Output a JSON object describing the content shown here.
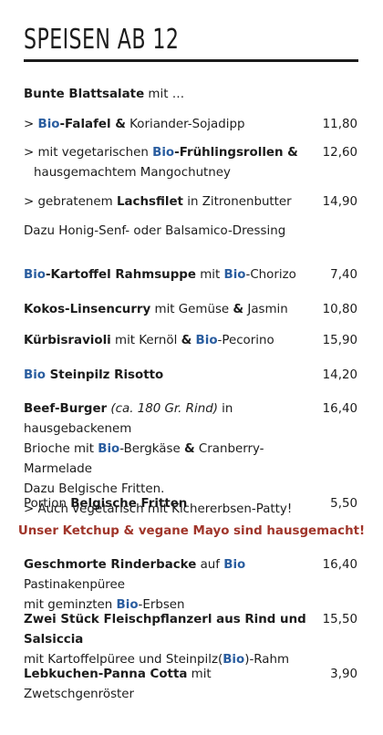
{
  "title": "SPEISEN AB 12",
  "salads": {
    "heading_bold": "Bunte Blattsalate",
    "heading_rest": " mit …",
    "falafel": {
      "prefix": "> ",
      "bio": "Bio",
      "name": "-Falafel &",
      "rest": " Koriander-Sojadipp",
      "price": "11,80"
    },
    "spring_rolls": {
      "line1_a": "> mit vegetarischen ",
      "bio": "Bio",
      "name": "-Frühlingsrollen &",
      "line2": "hausgemachtem Mangochutney",
      "price": "12,60"
    },
    "salmon": {
      "line_a": "> gebratenem ",
      "name": "Lachsfilet",
      "rest": " in Zitronenbutter",
      "price": "14,90"
    },
    "dressing": "Dazu Honig-Senf- oder Balsamico-Dressing"
  },
  "soup": {
    "bio1": "Bio",
    "name": "-Kartoffel Rahmsuppe",
    "mid": " mit ",
    "bio2": "Bio",
    "rest": "-Chorizo",
    "price": "7,40"
  },
  "curry": {
    "name": "Kokos-Linsencurry",
    "rest_a": " mit Gemüse ",
    "amp": "&",
    "rest_b": " Jasmin",
    "price": "10,80"
  },
  "ravioli": {
    "name": "Kürbisravioli",
    "rest_a": " mit Kernöl ",
    "amp": "&",
    "space": " ",
    "bio": "Bio",
    "rest_b": "-Pecorino",
    "price": "15,90"
  },
  "risotto": {
    "bio": "Bio",
    "name": " Steinpilz Risotto",
    "price": "14,20"
  },
  "burger": {
    "name": "Beef-Burger",
    "weight": " (ca. 180 Gr. Rind)",
    "rest1": " in hausgebackenem",
    "line2_a": "Brioche mit ",
    "bio": "Bio",
    "line2_b": "-Bergkäse ",
    "amp": "&",
    "line2_c": " Cranberry-Marmelade",
    "line3": "Dazu Belgische Fritten.",
    "line4": "> Auch vegetarisch mit Kichererbsen-Patty!",
    "price": "16,40"
  },
  "fries": {
    "prefix": "Portion ",
    "name": "Belgische Fritten",
    "price": "5,50"
  },
  "ketchup_note": "Unser Ketchup & vegane Mayo sind hausgemacht!",
  "cheek": {
    "name": "Geschmorte Rinderbacke",
    "mid": " auf ",
    "bio1": "Bio",
    "rest1": " Pastinakenpüree",
    "line2_a": "mit geminzten ",
    "bio2": "Bio",
    "line2_b": "-Erbsen",
    "price": "16,40"
  },
  "fleischpflanzerl": {
    "name": "Zwei Stück Fleischpflanzerl aus Rind und Salsiccia",
    "line2_a": "mit Kartoffelpüree und Steinpilz(",
    "bio": "Bio",
    "line2_b": ")-Rahm",
    "price": "15,50"
  },
  "panna_cotta": {
    "name": "Lebkuchen-Panna Cotta",
    "rest": " mit Zwetschgenröster",
    "price": "3,90"
  }
}
